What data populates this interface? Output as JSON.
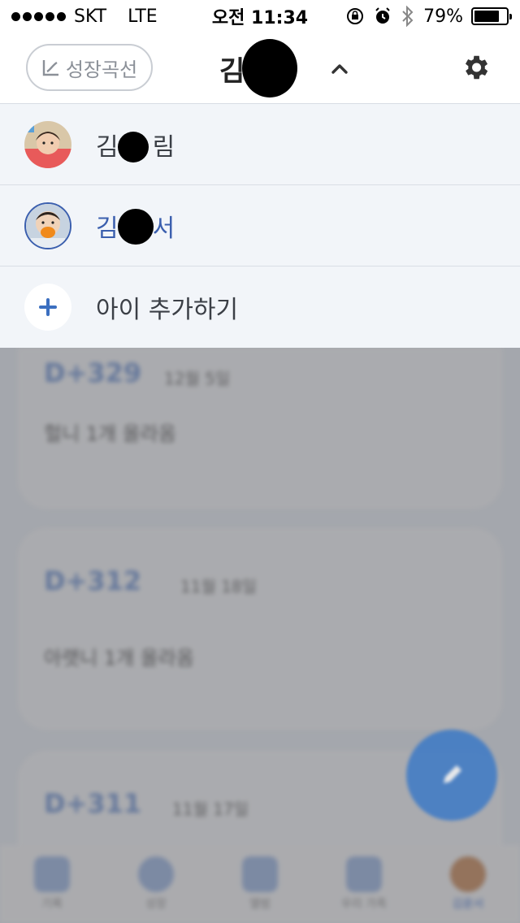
{
  "status_bar": {
    "carrier": "SKT",
    "network": "LTE",
    "time": "오전 11:34",
    "battery_percent": "79%",
    "battery_level": 0.79
  },
  "header": {
    "growth_button_label": "성장곡선",
    "title": "김",
    "chevron_icon": "chevron-up-icon",
    "settings_icon": "gear-icon"
  },
  "dropdown": {
    "items": [
      {
        "label_start": "김",
        "label_end": "림",
        "avatar": "baby-girl-photo",
        "selected": false
      },
      {
        "label_start": "김",
        "label_end": "서",
        "avatar": "baby-boy-photo",
        "selected": true
      }
    ],
    "add_label": "아이 추가하기",
    "add_icon": "plus-icon"
  },
  "background_cards": [
    {
      "day": "D+329",
      "date": "12월 5일",
      "text": "헐니 1개 올라옴"
    },
    {
      "day": "D+312",
      "date": "11월 18일",
      "text": "아랫니 1개 올라옴"
    },
    {
      "day": "D+311",
      "date": "11월 17일",
      "text": ""
    }
  ],
  "tab_bar": {
    "tabs": [
      {
        "label": "기록",
        "icon": "alarm-icon",
        "active": false
      },
      {
        "label": "성장",
        "icon": "chart-icon",
        "active": false
      },
      {
        "label": "앨범",
        "icon": "gallery-icon",
        "active": false
      },
      {
        "label": "우리 가족",
        "icon": "home-icon",
        "active": false
      },
      {
        "label": "김윤서",
        "icon": "avatar-icon",
        "active": true
      }
    ]
  },
  "colors": {
    "accent": "#3b5fae",
    "fab": "#2e73c9",
    "card_day": "#6f93d3"
  }
}
